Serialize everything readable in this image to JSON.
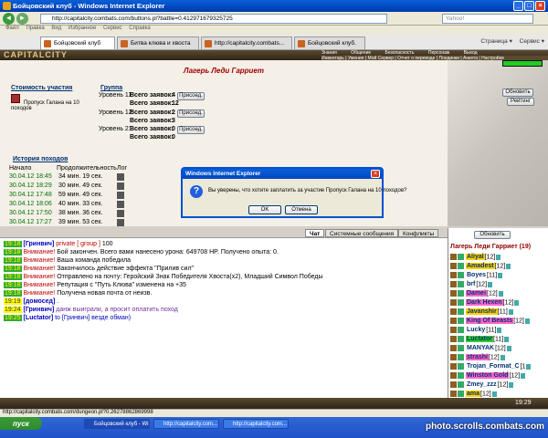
{
  "window": {
    "title": "Бойцовский клуб - Windows Internet Explorer"
  },
  "address": {
    "url": "http://capitalcity.combats.com/buttons.pl?battle=0.412971679325725",
    "search_placeholder": "Yahoo!"
  },
  "menu": [
    "Файл",
    "Правка",
    "Вид",
    "Избранное",
    "Сервис",
    "Справка"
  ],
  "tabs": [
    {
      "label": "Бойцовский клуб"
    },
    {
      "label": "Битва клюва и хвоста"
    },
    {
      "label": "http://capitalcity.combats..."
    },
    {
      "label": "Бойцовский клуб."
    }
  ],
  "toolbar_right": {
    "page": "Страница",
    "service": "Сервис"
  },
  "game": {
    "logo": "CAPITALCITY",
    "topnav": [
      "Знания",
      "Общение",
      "Безопасность",
      "Персонаж",
      "Выход"
    ],
    "topnav2": [
      "Инвентарь",
      "Умения",
      "Мой Сервер",
      "Отчет о переводе",
      "Поединки",
      "Анкета",
      "Настройки"
    ],
    "page_title": "Лагерь Леди Гарриет"
  },
  "cost": {
    "header": "Стоимость участия",
    "item": "Пропуск Галана на 10 походов"
  },
  "groups": {
    "header": "Группа",
    "rows": [
      {
        "level": "Уровень 11",
        "label": "Всего заявок:",
        "value": "4",
        "button": "Присоед."
      },
      {
        "level": "",
        "label": "Всего заявок:",
        "value": "12",
        "button": ""
      },
      {
        "level": "Уровень 12",
        "label": "Всего заявок:",
        "value": "2",
        "button": "Присоед."
      },
      {
        "level": "",
        "label": "Всего заявок:",
        "value": "3",
        "button": ""
      },
      {
        "level": "Уровень 21",
        "label": "Всего заявок:",
        "value": "0",
        "button": "Присоед."
      },
      {
        "level": "",
        "label": "Всего заявок:",
        "value": "0",
        "button": ""
      }
    ]
  },
  "history": {
    "header": "История походов",
    "col_start": "Начало",
    "col_duration": "Продолжительность",
    "col_log": "Лог",
    "rows": [
      {
        "date": "30.04.12 18:45",
        "dur": "34 мин. 19 сек."
      },
      {
        "date": "30.04.12 18:29",
        "dur": "30 мин. 49 сек."
      },
      {
        "date": "30.04.12 17:48",
        "dur": "59 мин. 49 сек."
      },
      {
        "date": "30.04.12 18:06",
        "dur": "40 мин. 33 сек."
      },
      {
        "date": "30.04.12 17:50",
        "dur": "38 мин. 36 сек."
      },
      {
        "date": "30.04.12 17:27",
        "dur": "39 мин. 53 сек."
      }
    ]
  },
  "right_buttons": {
    "update": "Обновить",
    "rating": "Рейтинг",
    "chat_update": "Обновить"
  },
  "dialog": {
    "title": "Windows Internet Explorer",
    "text": "Вы уверены, что хотите заплатить за участие Пропуск Галана на 10 походов?",
    "ok": "OK",
    "cancel": "Отмена"
  },
  "chat_tabs": [
    "Чат",
    "Системные сообщения",
    "Конфликты"
  ],
  "chat": [
    {
      "time": "19:18",
      "who": "[Гринвич]",
      "tag": "private [ group ]",
      "msg": "100",
      "kind": "private"
    },
    {
      "time": "19:18",
      "who": "",
      "tag": "Внимание!",
      "msg": "Бой закончен. Всего вами нанесено урона: 649708 HP. Получено опыта: 0.",
      "kind": "warn"
    },
    {
      "time": "19:18",
      "who": "",
      "tag": "Внимание!",
      "msg": "Ваша команда победила",
      "kind": "warn"
    },
    {
      "time": "19:18",
      "who": "",
      "tag": "Внимание!",
      "msg": "Закончилось действие эффекта \"Прилив сил\"",
      "kind": "warn"
    },
    {
      "time": "19:18",
      "who": "",
      "tag": "Внимание!",
      "msg": "Отправлено на почту: Геройский Знак Победителя Хвоста(x2), Младший Символ Победы",
      "kind": "warn"
    },
    {
      "time": "19:18",
      "who": "",
      "tag": "Внимание!",
      "msg": "Репутация с \"Путь Клюва\" изменена на +35",
      "kind": "warn"
    },
    {
      "time": "19:18",
      "who": "",
      "tag": "Внимание!",
      "msg": "Получена новая почта от неизв.",
      "kind": "warn"
    },
    {
      "time": "19:19",
      "who": "[домосед]",
      "tag": "",
      "msg": ".",
      "kind": "plain"
    },
    {
      "time": "19:24",
      "who": "[Гринвич]",
      "tag": "",
      "msg": "данж выиграли, а просит оплатить поход",
      "kind": "plain2"
    },
    {
      "time": "19:25",
      "who": "[Luctator]",
      "tag": "to [Гринвич]",
      "msg": "везде обман)",
      "kind": "to"
    }
  ],
  "online": {
    "header": "Лагерь Леди Гарриет (19)",
    "users": [
      {
        "name": "Aliyal",
        "lvl": "[12]",
        "hl": "#ffd000"
      },
      {
        "name": "Amadest",
        "lvl": "[12]",
        "hl": "#ffd000"
      },
      {
        "name": "Boyes",
        "lvl": "[11]",
        "hl": ""
      },
      {
        "name": "brf",
        "lvl": "[12]",
        "hl": ""
      },
      {
        "name": "Damei",
        "lvl": "[12]",
        "hl": "#ff66cc"
      },
      {
        "name": "Dark Hexen",
        "lvl": "[12]",
        "hl": "#ff66cc"
      },
      {
        "name": "Javanshir",
        "lvl": "[11]",
        "hl": "#ffd000"
      },
      {
        "name": "King Of Beasts",
        "lvl": "[12]",
        "hl": "#ff66cc"
      },
      {
        "name": "Lucky",
        "lvl": "[11]",
        "hl": ""
      },
      {
        "name": "Luctator",
        "lvl": "[11]",
        "hl": "#33cc33"
      },
      {
        "name": "MANYAK",
        "lvl": "[12]",
        "hl": ""
      },
      {
        "name": "strashi",
        "lvl": "[12]",
        "hl": "#ff66cc"
      },
      {
        "name": "Trojan_Format_C",
        "lvl": "[1",
        "hl": ""
      },
      {
        "name": "Winston Gold",
        "lvl": "[12]",
        "hl": "#ff66cc"
      },
      {
        "name": "Zmey_zzz",
        "lvl": "[12]",
        "hl": ""
      },
      {
        "name": "ama",
        "lvl": "[12]",
        "hl": "#ffd000"
      },
      {
        "name": "Везир",
        "lvl": "[12]",
        "hl": ""
      },
      {
        "name": "Гринвич",
        "lvl": "[12]",
        "hl": "#33cc33"
      }
    ]
  },
  "status": {
    "text": "http://capitalcity.combats.com/dungeon.pl?0.26278862869998"
  },
  "taskbar": {
    "start": "пуск",
    "tasks": [
      "Бойцовский клуб - Win...",
      "http://capitalcity.com...",
      "http://capitalcity.com..."
    ],
    "clock": "19:29",
    "watermark": "photo.scrolls.combats.com"
  }
}
